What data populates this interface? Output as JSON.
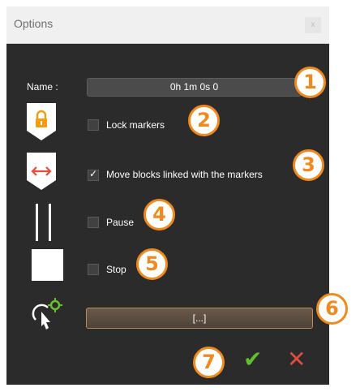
{
  "window": {
    "title": "Options",
    "close_label": "x"
  },
  "name_row": {
    "label": "Name :",
    "value": "0h 1m 0s 0"
  },
  "options": [
    {
      "label": "Lock markers",
      "checked": false,
      "icon": "lock-icon"
    },
    {
      "label": "Move blocks linked with the markers",
      "checked": true,
      "icon": "move-arrows-icon"
    },
    {
      "label": "Pause",
      "checked": false,
      "icon": "pause-icon"
    },
    {
      "label": "Stop",
      "checked": false,
      "icon": "stop-icon"
    }
  ],
  "action_row": {
    "icon": "click-gear-icon",
    "button_label": "[...]"
  },
  "footer": {
    "ok_icon": "checkmark-icon",
    "cancel_icon": "close-x-icon"
  },
  "callouts": [
    "1",
    "2",
    "3",
    "4",
    "5",
    "6",
    "7"
  ],
  "colors": {
    "dialog_bg": "#2b2b2b",
    "accent_orange": "#f08a1e",
    "ok_green": "#5fbf2f",
    "cancel_red": "#e24d3f",
    "lock_orange": "#f39c12",
    "arrow_red": "#e74c3c"
  }
}
